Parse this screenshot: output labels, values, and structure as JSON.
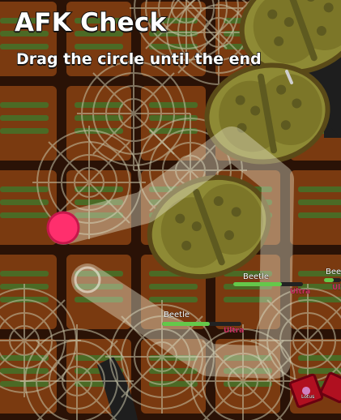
{
  "hud": {
    "title": "AFK Check",
    "subtitle": "Drag the circle until the end"
  },
  "mobs": [
    {
      "name": "Beetle",
      "rarity": "Ultra",
      "health": 0.7
    },
    {
      "name": "Beetle",
      "rarity": "Ultra",
      "health": 0.6
    },
    {
      "name": "Beetle",
      "rarity": "Ultra",
      "health": 0.55
    },
    {
      "name": "Beetle",
      "rarity": "Ultra",
      "health": 0.6
    }
  ],
  "drops": {
    "label": "Lotus"
  },
  "colors": {
    "background": "#3a1a08",
    "tile": "#7a3a10",
    "beetle": "#8e8a35",
    "track": "#e8e4cc",
    "handle": "#ff2f6d",
    "hp": "#64c84a",
    "rarity": "#d03060"
  }
}
